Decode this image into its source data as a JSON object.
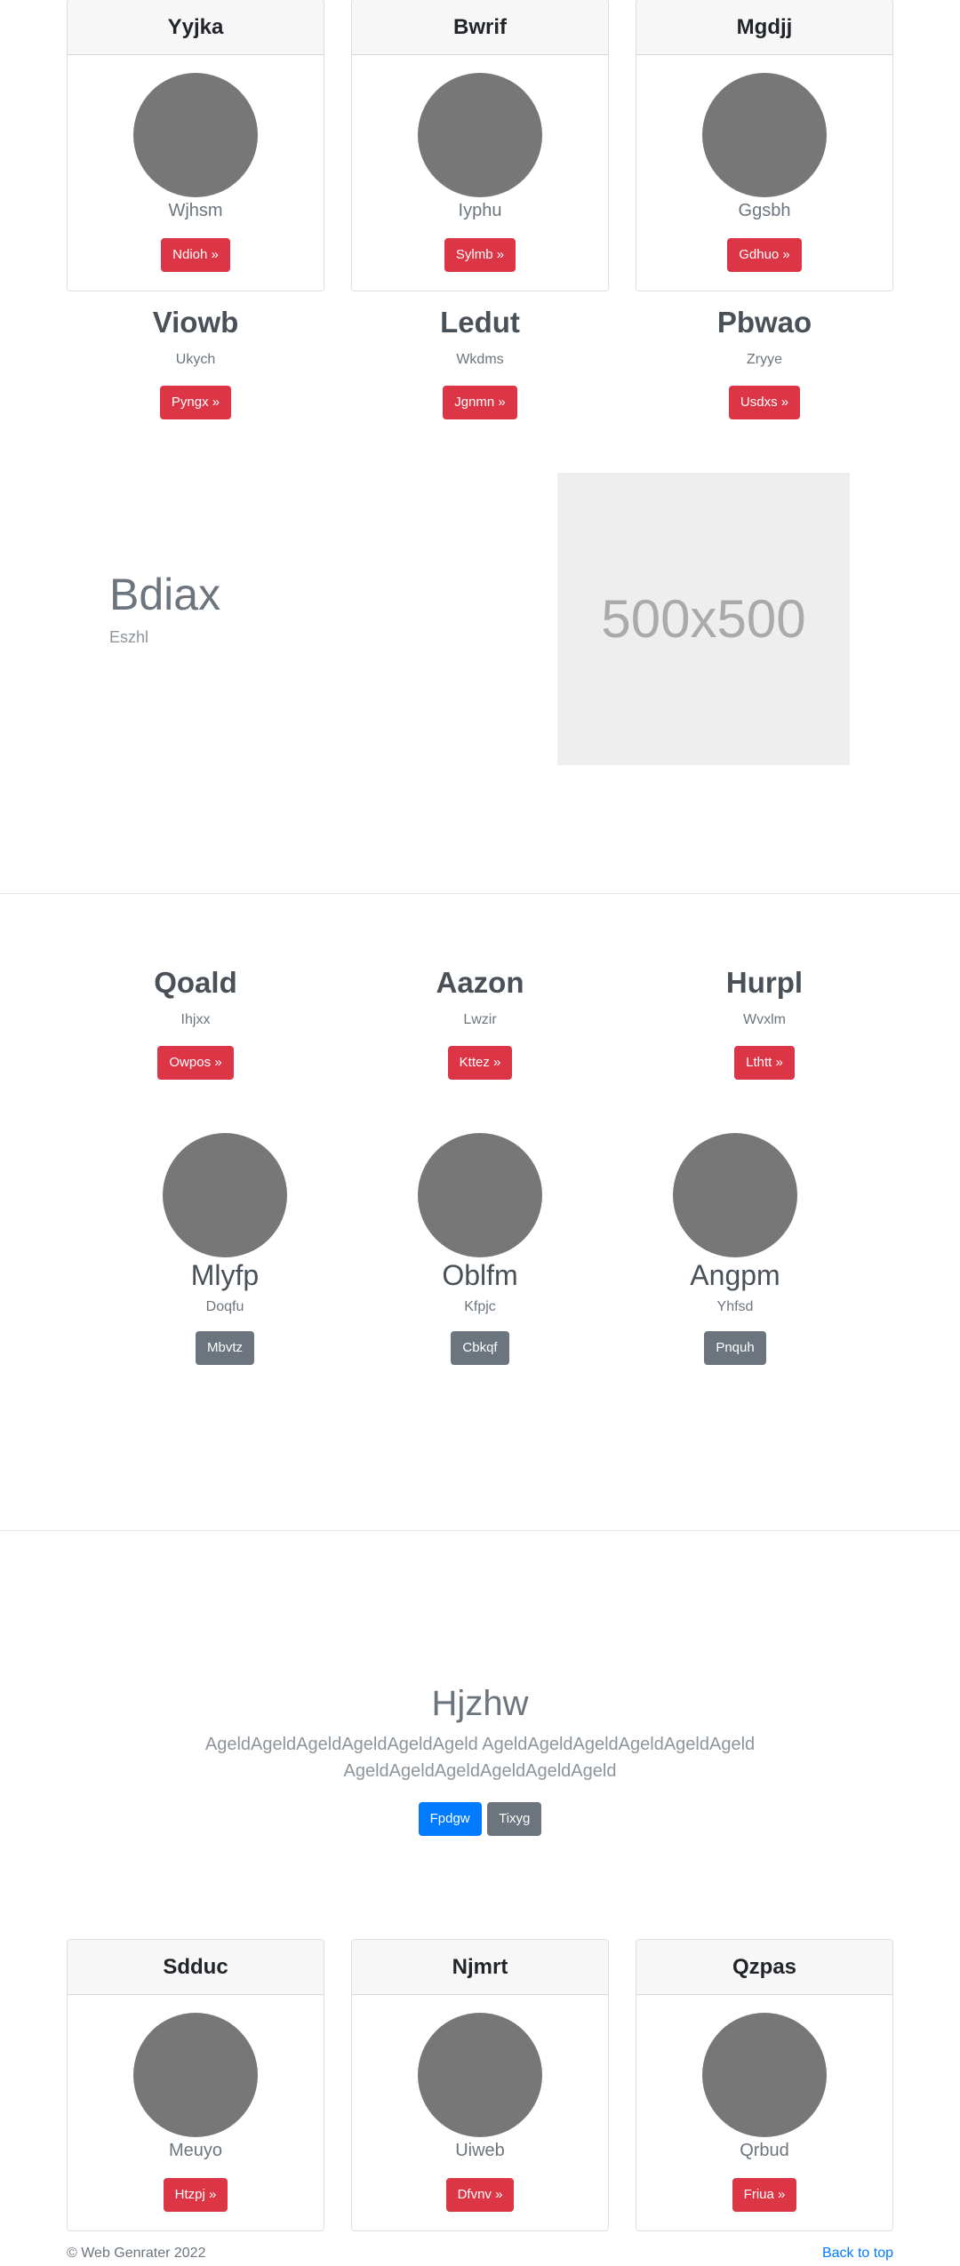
{
  "cards_top": [
    {
      "title": "Yyjka",
      "subtitle": "Wjhsm",
      "button": "Ndioh »"
    },
    {
      "title": "Bwrif",
      "subtitle": "Iyphu",
      "button": "Sylmb »"
    },
    {
      "title": "Mgdjj",
      "subtitle": "Ggsbh",
      "button": "Gdhuo »"
    }
  ],
  "columns_1": [
    {
      "heading": "Viowb",
      "text": "Ukych",
      "button": "Pyngx »"
    },
    {
      "heading": "Ledut",
      "text": "Wkdms",
      "button": "Jgnmn »"
    },
    {
      "heading": "Pbwao",
      "text": "Zryye",
      "button": "Usdxs »"
    }
  ],
  "feature": {
    "title": "Bdiax",
    "subtitle": "Eszhl",
    "image_label": "500x500"
  },
  "columns_2": [
    {
      "heading": "Qoald",
      "text": "Ihjxx",
      "button": "Owpos »"
    },
    {
      "heading": "Aazon",
      "text": "Lwzir",
      "button": "Kttez »"
    },
    {
      "heading": "Hurpl",
      "text": "Wvxlm",
      "button": "Lthtt »"
    }
  ],
  "team": [
    {
      "name": "Mlyfp",
      "role": "Doqfu",
      "button": "Mbvtz"
    },
    {
      "name": "Oblfm",
      "role": "Kfpjc",
      "button": "Cbkqf"
    },
    {
      "name": "Angpm",
      "role": "Yhfsd",
      "button": "Pnquh"
    }
  ],
  "hero": {
    "title": "Hjzhw",
    "line1": "AgeldAgeldAgeldAgeldAgeldAgeld AgeldAgeldAgeldAgeldAgeldAgeld",
    "line2": "AgeldAgeldAgeldAgeldAgeldAgeld",
    "primary_button": "Fpdgw",
    "secondary_button": "Tixyg"
  },
  "cards_bottom": [
    {
      "title": "Sdduc",
      "subtitle": "Meuyo",
      "button": "Htzpj »"
    },
    {
      "title": "Njmrt",
      "subtitle": "Uiweb",
      "button": "Dfvnv »"
    },
    {
      "title": "Qzpas",
      "subtitle": "Qrbud",
      "button": "Friua »"
    }
  ],
  "footer": {
    "copyright": "© Web Genrater 2022",
    "back_to_top": "Back to top"
  },
  "colors": {
    "danger": "#dc3545",
    "secondary": "#6c757d",
    "primary": "#007bff",
    "avatar": "#777777",
    "placeholder": "#eeeeee"
  }
}
